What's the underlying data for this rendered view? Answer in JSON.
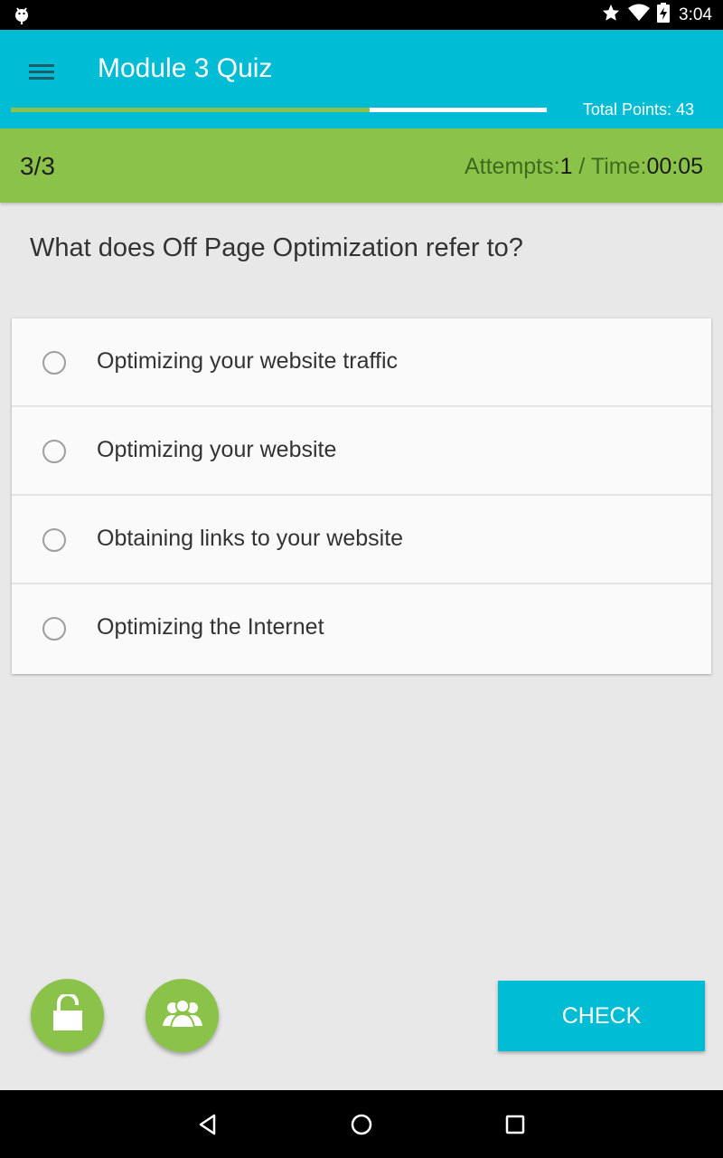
{
  "status_bar": {
    "time": "3:04",
    "icons": [
      "android-debug-icon",
      "star-icon",
      "wifi-icon",
      "battery-charging-icon"
    ]
  },
  "app_bar": {
    "title": "Module 3 Quiz",
    "menu_icon": "hamburger-menu-icon",
    "progress_fraction": 0.67,
    "total_points_label": "Total Points: 43"
  },
  "info_strip": {
    "counter": "3/3",
    "attempts_label": "Attempts:",
    "attempts_value": "1",
    "separator": " / ",
    "time_label": "Time:",
    "time_value": "00:05"
  },
  "question": {
    "text": "What does Off Page Optimization refer to?"
  },
  "options": [
    {
      "label": "Optimizing your website traffic",
      "selected": false
    },
    {
      "label": "Optimizing your website",
      "selected": false
    },
    {
      "label": "Obtaining links to your website",
      "selected": false
    },
    {
      "label": "Optimizing the Internet",
      "selected": false
    }
  ],
  "actions": {
    "lock_icon": "lock-open-icon",
    "group_icon": "group-icon",
    "check_label": "CHECK"
  },
  "colors": {
    "primary": "#00bcd4",
    "accent": "#8bc34a",
    "background": "#e8e8e8"
  }
}
